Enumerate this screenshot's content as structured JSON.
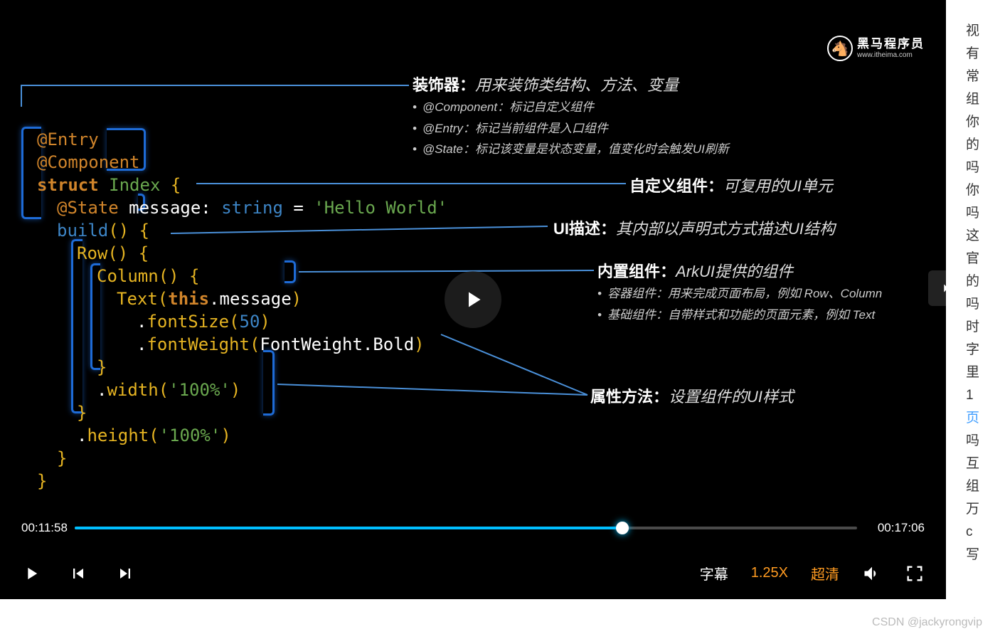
{
  "logo": {
    "title": "黑马程序员",
    "sub": "www.itheima.com"
  },
  "code": {
    "l1": "@Entry",
    "l2": "@Component",
    "l3_kw": "struct",
    "l3_id": " Index ",
    "l3_b": "{",
    "l4_dec": "@State",
    "l4_var": " message: ",
    "l4_type": "string",
    "l4_eq": " = ",
    "l4_str": "'Hello World'",
    "l5_fn": "build",
    "l5_p": "() {",
    "l6_call": "Row",
    "l6_p": "() {",
    "l7_call": "Column",
    "l7_p": "() {",
    "l8_call": "Text",
    "l8_po": "(",
    "l8_this": "this",
    "l8_dot": ".message",
    "l8_pc": ")",
    "l9_dot": ".",
    "l9_fn": "fontSize",
    "l9_po": "(",
    "l9_num": "50",
    "l9_pc": ")",
    "l10_dot": ".",
    "l10_fn": "fontWeight",
    "l10_po": "(",
    "l10_arg": "FontWeight.Bold",
    "l10_pc": ")",
    "l11": "}",
    "l12_dot": ".",
    "l12_fn": "width",
    "l12_po": "(",
    "l12_str": "'100%'",
    "l12_pc": ")",
    "l13": "}",
    "l14_dot": ".",
    "l14_fn": "height",
    "l14_po": "(",
    "l14_str": "'100%'",
    "l14_pc": ")",
    "l15": "}",
    "l16": "}"
  },
  "ann": {
    "a1_t": "装饰器：",
    "a1_d": "用来装饰类结构、方法、变量",
    "a1_s1": "@Component：标记自定义组件",
    "a1_s2": "@Entry：标记当前组件是入口组件",
    "a1_s3": "@State：标记该变量是状态变量，值变化时会触发UI刷新",
    "a2_t": "自定义组件：",
    "a2_d": "可复用的UI单元",
    "a3_t": "UI描述：",
    "a3_d": "其内部以声明式方式描述UI结构",
    "a4_t": "内置组件：",
    "a4_d": "ArkUI提供的组件",
    "a4_s1": "容器组件：用来完成页面布局，例如 Row、Column",
    "a4_s2": "基础组件：自带样式和功能的页面元素，例如 Text",
    "a5_t": "属性方法：",
    "a5_d": "设置组件的UI样式"
  },
  "player": {
    "current": "00:11:58",
    "total": "00:17:06",
    "progress_pct": 70,
    "subtitle": "字幕",
    "speed": "1.25X",
    "quality": "超清"
  },
  "watermark": "CSDN @jackyrongvip",
  "sidebar": {
    "items": [
      "视",
      "有",
      "常",
      "组",
      "你",
      "的",
      "吗",
      "你",
      "吗",
      "这",
      "官",
      "的",
      "吗",
      "时",
      "字",
      "里",
      "1",
      "页",
      "吗",
      "互",
      "组",
      "万",
      "c",
      "写"
    ],
    "blue_index": 17
  }
}
